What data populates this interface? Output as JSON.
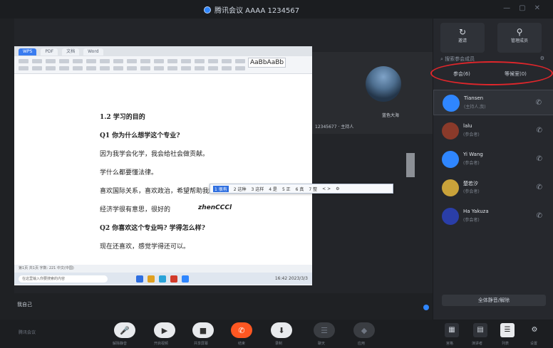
{
  "window": {
    "title": "腾讯会议 AAAA 1234567",
    "controls": [
      "—",
      "▢",
      "✕"
    ]
  },
  "shared_doc": {
    "tabs": [
      "WPS",
      "PDF",
      "文档",
      "Word"
    ],
    "style_preview": "AaBbAaBb",
    "lines": [
      "1.2 学习的目的",
      "Q1 你为什么想学这个专业?",
      "因为我学会化学，我会给社会做贡献。",
      "学什么都要懂法律。",
      "喜欢国际关系，喜欢政治，希望帮助我的国家。",
      "经济学很有意思，很好的",
      "Q2 你喜欢这个专业吗? 学得怎么样?",
      "现在还喜欢，感觉学得还可以。"
    ],
    "ime_input": "zhenCCCl",
    "ime_candidates": [
      "1 很有",
      "2 这种",
      "3 这样",
      "4 是",
      "5 正",
      "6 真",
      "7 整",
      "< >",
      "⚙"
    ],
    "status_strip": "第1页 共1页  字数: 221  中文(中国)",
    "taskbar_search": "在这里输入你要搜索的内容",
    "tray": "16:42 2023/3/3"
  },
  "speaker": {
    "name": "蓝色大海",
    "id": "12345677 · 主持人"
  },
  "local_user": {
    "name": "我自己"
  },
  "side_panel": {
    "buttons": [
      {
        "icon": "↻",
        "label": "邀请"
      },
      {
        "icon": "⚲",
        "label": "管理成员"
      }
    ],
    "search_placeholder": "搜索参会成员",
    "tabs": [
      "参会(6)",
      "等候室(0)"
    ],
    "members": [
      {
        "name": "Tiansen",
        "sub": "(主持人,我)",
        "avatar_color": "#2f86ff"
      },
      {
        "name": "lalu",
        "sub": "(参会者)",
        "avatar_color": "#8a3a2a"
      },
      {
        "name": "Yi Wang",
        "sub": "(参会者)",
        "avatar_color": "#2f86ff"
      },
      {
        "name": "楚若汐",
        "sub": "(参会者)",
        "avatar_color": "#c9a23a"
      },
      {
        "name": "Ha Yakuza",
        "sub": "(参会者)",
        "avatar_color": "#2a3ea8"
      }
    ],
    "invite_button": "全体静音/解除"
  },
  "bottom_bar": {
    "brand": "腾讯会议",
    "controls": [
      {
        "icon": "🎤",
        "label": "解除静音"
      },
      {
        "icon": "▶",
        "label": "开启视频"
      },
      {
        "icon": "■",
        "label": "共享屏幕"
      },
      {
        "icon": "✆",
        "label": "结束"
      },
      {
        "icon": "⬇",
        "label": "录制"
      },
      {
        "icon": "☰",
        "label": "聊天"
      },
      {
        "icon": "◆",
        "label": "应用"
      }
    ],
    "layouts": [
      {
        "icon": "▦",
        "label": "宫格"
      },
      {
        "icon": "▤",
        "label": "演讲者"
      },
      {
        "icon": "☰",
        "label": "列表"
      },
      {
        "icon": "⚙",
        "label": "设置"
      }
    ]
  }
}
